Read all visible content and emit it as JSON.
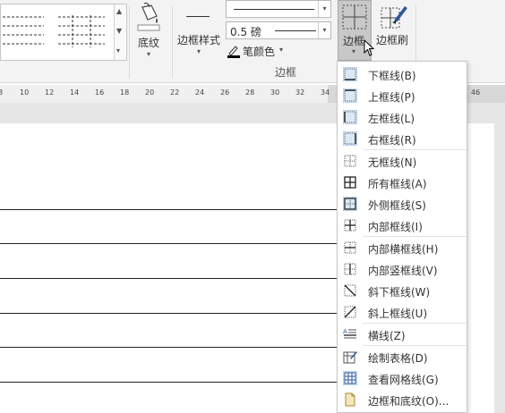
{
  "ribbon": {
    "shading": {
      "label": "底纹"
    },
    "border_styles": {
      "label": "边框样式"
    },
    "pen_weight": {
      "value": "0.5 磅"
    },
    "pen_color": {
      "label": "笔颜色"
    },
    "borders_button": {
      "label": "边框"
    },
    "border_painter": {
      "label": "边框刷"
    },
    "group_label": "边框"
  },
  "ruler": {
    "ticks": [
      "8",
      "10",
      "12",
      "14",
      "16",
      "18",
      "20",
      "22",
      "24",
      "26",
      "28",
      "30",
      "32",
      "34",
      "36",
      "38"
    ],
    "right_tick": "46"
  },
  "menu": {
    "items": [
      {
        "label": "下框线(B)",
        "icon": "bottom-border-icon"
      },
      {
        "label": "上框线(P)",
        "icon": "top-border-icon"
      },
      {
        "label": "左框线(L)",
        "icon": "left-border-icon"
      },
      {
        "label": "右框线(R)",
        "icon": "right-border-icon"
      },
      {
        "label": "无框线(N)",
        "icon": "no-border-icon"
      },
      {
        "label": "所有框线(A)",
        "icon": "all-borders-icon"
      },
      {
        "label": "外侧框线(S)",
        "icon": "outside-borders-icon"
      },
      {
        "label": "内部框线(I)",
        "icon": "inside-borders-icon"
      },
      {
        "label": "内部横框线(H)",
        "icon": "inside-horizontal-border-icon"
      },
      {
        "label": "内部竖框线(V)",
        "icon": "inside-vertical-border-icon"
      },
      {
        "label": "斜下框线(W)",
        "icon": "diagonal-down-border-icon"
      },
      {
        "label": "斜上框线(U)",
        "icon": "diagonal-up-border-icon"
      },
      {
        "label": "横线(Z)",
        "icon": "horizontal-line-icon"
      },
      {
        "label": "绘制表格(D)",
        "icon": "draw-table-icon"
      },
      {
        "label": "查看网格线(G)",
        "icon": "view-gridlines-icon"
      },
      {
        "label": "边框和底纹(O)...",
        "icon": "borders-and-shading-icon"
      }
    ]
  },
  "colors": {
    "accent": "#2b579a",
    "ribbon_bg": "#f3f3f3",
    "button_pressed": "#c8c8c8"
  }
}
